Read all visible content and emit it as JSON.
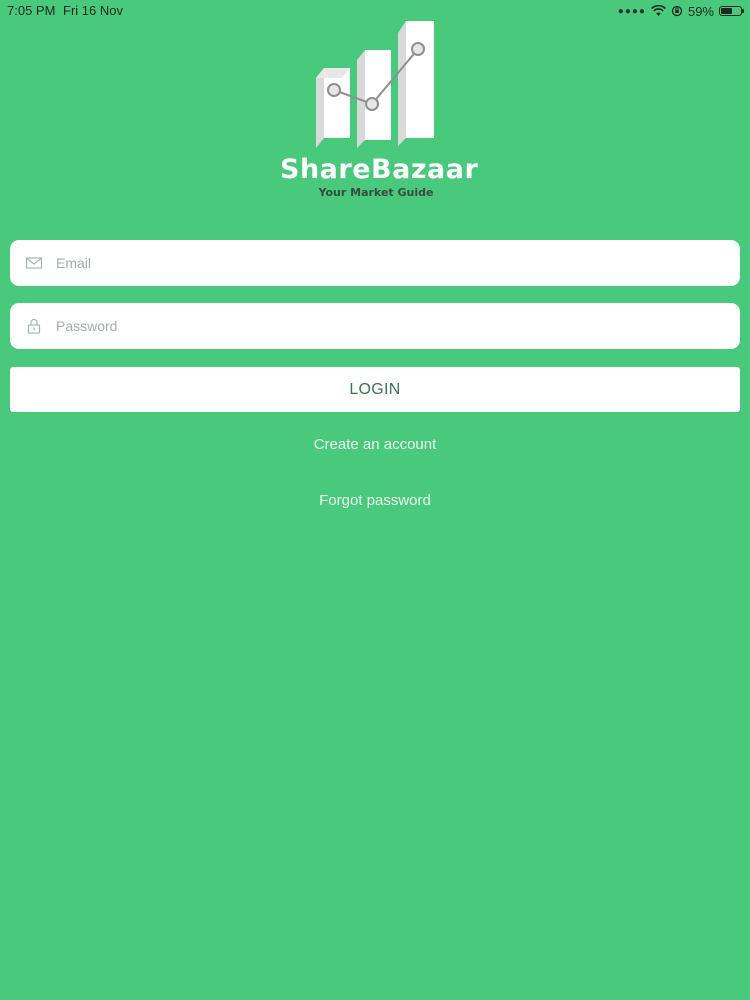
{
  "status_bar": {
    "time": "7:05 PM",
    "date": "Fri 16 Nov",
    "battery_percent": "59%",
    "battery_level": 0.59,
    "icons": [
      "signal-dots-icon",
      "wifi-icon",
      "orientation-lock-icon",
      "battery-icon"
    ]
  },
  "brand": {
    "name": "ShareBazaar",
    "tagline": "Your Market Guide",
    "logo_icon": "bar-chart-trend-logo"
  },
  "form": {
    "email": {
      "placeholder": "Email",
      "value": "",
      "icon": "envelope-icon"
    },
    "password": {
      "placeholder": "Password",
      "value": "",
      "icon": "lock-icon"
    },
    "login_label": "LOGIN",
    "create_account_label": "Create an account",
    "forgot_password_label": "Forgot password"
  },
  "colors": {
    "background": "#49c97c",
    "field_background": "#ffffff",
    "login_text": "#3f7356",
    "placeholder": "#a7aeab"
  }
}
